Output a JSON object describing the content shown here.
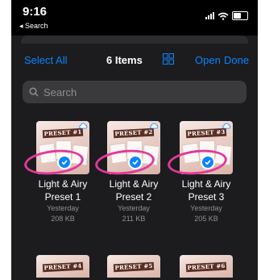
{
  "status": {
    "time": "9:16",
    "back_label": "◂ Search"
  },
  "toolbar": {
    "select_all": "Select All",
    "title": "6 Items",
    "open": "Open",
    "done": "Done"
  },
  "search": {
    "placeholder": "Search"
  },
  "items": [
    {
      "name": "Light & Airy Preset 1",
      "line1": "Light & Airy",
      "line2": "Preset 1",
      "date": "Yesterday",
      "size": "208 KB",
      "thumb_text": "PRESET #1",
      "selected": true
    },
    {
      "name": "Light & Airy Preset 2",
      "line1": "Light & Airy",
      "line2": "Preset 2",
      "date": "Yesterday",
      "size": "211 KB",
      "thumb_text": "PRESET #2",
      "selected": true
    },
    {
      "name": "Light & Airy Preset 3",
      "line1": "Light & Airy",
      "line2": "Preset 3",
      "date": "Yesterday",
      "size": "205 KB",
      "thumb_text": "PRESET #3",
      "selected": true
    },
    {
      "thumb_text": "PRESET #4"
    },
    {
      "thumb_text": "PRESET #5"
    },
    {
      "thumb_text": "PRESET #6"
    }
  ],
  "colors": {
    "accent": "#0a84ff",
    "highlight": "#e0399b",
    "background": "#1c1c1e"
  }
}
